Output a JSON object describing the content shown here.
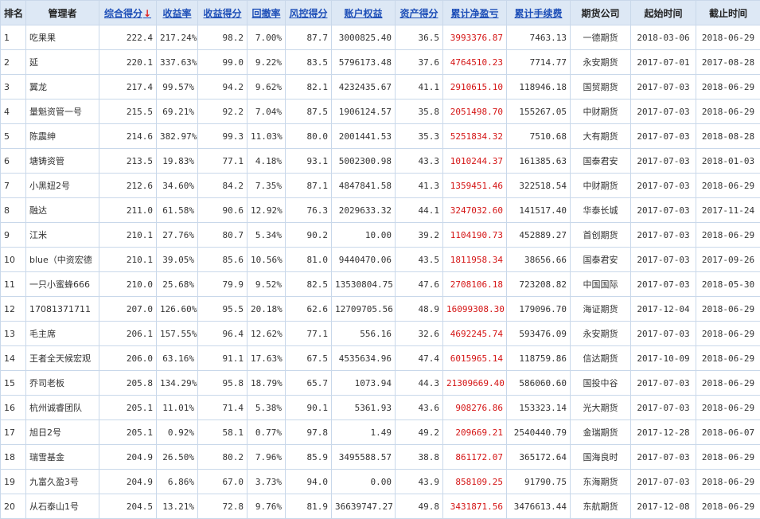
{
  "table": {
    "headers": {
      "rank": "排名",
      "manager": "管理者",
      "composite": "综合得分",
      "return_rate": "收益率",
      "return_score": "收益得分",
      "drawdown": "回撤率",
      "risk_score": "风控得分",
      "equity": "账户权益",
      "asset_score": "资产得分",
      "net_profit": "累计净盈亏",
      "fees": "累计手续费",
      "broker": "期货公司",
      "start": "起始时间",
      "end": "截止时间"
    },
    "sort_icon": "arrow-down-icon",
    "rows": [
      {
        "rank": "1",
        "manager": "吃果果",
        "composite": "222.4",
        "return_rate": "217.24%",
        "return_score": "98.2",
        "drawdown": "7.00%",
        "risk_score": "87.7",
        "equity": "3000825.40",
        "asset_score": "36.5",
        "net_profit": "3993376.87",
        "fees": "7463.13",
        "broker": "一德期货",
        "start": "2018-03-06",
        "end": "2018-06-29"
      },
      {
        "rank": "2",
        "manager": "延",
        "composite": "220.1",
        "return_rate": "337.63%",
        "return_score": "99.0",
        "drawdown": "9.22%",
        "risk_score": "83.5",
        "equity": "5796173.48",
        "asset_score": "37.6",
        "net_profit": "4764510.23",
        "fees": "7714.77",
        "broker": "永安期货",
        "start": "2017-07-01",
        "end": "2017-08-28"
      },
      {
        "rank": "3",
        "manager": "翼龙",
        "composite": "217.4",
        "return_rate": "99.57%",
        "return_score": "94.2",
        "drawdown": "9.62%",
        "risk_score": "82.1",
        "equity": "4232435.67",
        "asset_score": "41.1",
        "net_profit": "2910615.10",
        "fees": "118946.18",
        "broker": "国贸期货",
        "start": "2017-07-03",
        "end": "2018-06-29"
      },
      {
        "rank": "4",
        "manager": "量魁资管一号",
        "composite": "215.5",
        "return_rate": "69.21%",
        "return_score": "92.2",
        "drawdown": "7.04%",
        "risk_score": "87.5",
        "equity": "1906124.57",
        "asset_score": "35.8",
        "net_profit": "2051498.70",
        "fees": "155267.05",
        "broker": "中财期货",
        "start": "2017-07-03",
        "end": "2018-06-29"
      },
      {
        "rank": "5",
        "manager": "陈震绅",
        "composite": "214.6",
        "return_rate": "382.97%",
        "return_score": "99.3",
        "drawdown": "11.03%",
        "risk_score": "80.0",
        "equity": "2001441.53",
        "asset_score": "35.3",
        "net_profit": "5251834.32",
        "fees": "7510.68",
        "broker": "大有期货",
        "start": "2017-07-03",
        "end": "2018-08-28"
      },
      {
        "rank": "6",
        "manager": "塘铸资管",
        "composite": "213.5",
        "return_rate": "19.83%",
        "return_score": "77.1",
        "drawdown": "4.18%",
        "risk_score": "93.1",
        "equity": "5002300.98",
        "asset_score": "43.3",
        "net_profit": "1010244.37",
        "fees": "161385.63",
        "broker": "国泰君安",
        "start": "2017-07-03",
        "end": "2018-01-03"
      },
      {
        "rank": "7",
        "manager": "小黑妞2号",
        "composite": "212.6",
        "return_rate": "34.60%",
        "return_score": "84.2",
        "drawdown": "7.35%",
        "risk_score": "87.1",
        "equity": "4847841.58",
        "asset_score": "41.3",
        "net_profit": "1359451.46",
        "fees": "322518.54",
        "broker": "中财期货",
        "start": "2017-07-03",
        "end": "2018-06-29"
      },
      {
        "rank": "8",
        "manager": "融达",
        "composite": "211.0",
        "return_rate": "61.58%",
        "return_score": "90.6",
        "drawdown": "12.92%",
        "risk_score": "76.3",
        "equity": "2029633.32",
        "asset_score": "44.1",
        "net_profit": "3247032.60",
        "fees": "141517.40",
        "broker": "华泰长城",
        "start": "2017-07-03",
        "end": "2017-11-24"
      },
      {
        "rank": "9",
        "manager": "江米",
        "composite": "210.1",
        "return_rate": "27.76%",
        "return_score": "80.7",
        "drawdown": "5.34%",
        "risk_score": "90.2",
        "equity": "10.00",
        "asset_score": "39.2",
        "net_profit": "1104190.73",
        "fees": "452889.27",
        "broker": "首创期货",
        "start": "2017-07-03",
        "end": "2018-06-29"
      },
      {
        "rank": "10",
        "manager": "blue（中资宏德",
        "composite": "210.1",
        "return_rate": "39.05%",
        "return_score": "85.6",
        "drawdown": "10.56%",
        "risk_score": "81.0",
        "equity": "9440470.06",
        "asset_score": "43.5",
        "net_profit": "1811958.34",
        "fees": "38656.66",
        "broker": "国泰君安",
        "start": "2017-07-03",
        "end": "2017-09-26"
      },
      {
        "rank": "11",
        "manager": "一只小蜜蜂666",
        "composite": "210.0",
        "return_rate": "25.68%",
        "return_score": "79.9",
        "drawdown": "9.52%",
        "risk_score": "82.5",
        "equity": "13530804.75",
        "asset_score": "47.6",
        "net_profit": "2708106.18",
        "fees": "723208.82",
        "broker": "中国国际",
        "start": "2017-07-03",
        "end": "2018-05-30"
      },
      {
        "rank": "12",
        "manager": "17081371711",
        "composite": "207.0",
        "return_rate": "126.60%",
        "return_score": "95.5",
        "drawdown": "20.18%",
        "risk_score": "62.6",
        "equity": "12709705.56",
        "asset_score": "48.9",
        "net_profit": "16099308.30",
        "fees": "179096.70",
        "broker": "海证期货",
        "start": "2017-12-04",
        "end": "2018-06-29"
      },
      {
        "rank": "13",
        "manager": "毛主席",
        "composite": "206.1",
        "return_rate": "157.55%",
        "return_score": "96.4",
        "drawdown": "12.62%",
        "risk_score": "77.1",
        "equity": "556.16",
        "asset_score": "32.6",
        "net_profit": "4692245.74",
        "fees": "593476.09",
        "broker": "永安期货",
        "start": "2017-07-03",
        "end": "2018-06-29"
      },
      {
        "rank": "14",
        "manager": "王者全天候宏观",
        "composite": "206.0",
        "return_rate": "63.16%",
        "return_score": "91.1",
        "drawdown": "17.63%",
        "risk_score": "67.5",
        "equity": "4535634.96",
        "asset_score": "47.4",
        "net_profit": "6015965.14",
        "fees": "118759.86",
        "broker": "信达期货",
        "start": "2017-10-09",
        "end": "2018-06-29"
      },
      {
        "rank": "15",
        "manager": "乔司老板",
        "composite": "205.8",
        "return_rate": "134.29%",
        "return_score": "95.8",
        "drawdown": "18.79%",
        "risk_score": "65.7",
        "equity": "1073.94",
        "asset_score": "44.3",
        "net_profit": "21309669.40",
        "fees": "586060.60",
        "broker": "国投中谷",
        "start": "2017-07-03",
        "end": "2018-06-29"
      },
      {
        "rank": "16",
        "manager": "杭州诚睿团队",
        "composite": "205.1",
        "return_rate": "11.01%",
        "return_score": "71.4",
        "drawdown": "5.38%",
        "risk_score": "90.1",
        "equity": "5361.93",
        "asset_score": "43.6",
        "net_profit": "908276.86",
        "fees": "153323.14",
        "broker": "光大期货",
        "start": "2017-07-03",
        "end": "2018-06-29"
      },
      {
        "rank": "17",
        "manager": "旭日2号",
        "composite": "205.1",
        "return_rate": "0.92%",
        "return_score": "58.1",
        "drawdown": "0.77%",
        "risk_score": "97.8",
        "equity": "1.49",
        "asset_score": "49.2",
        "net_profit": "209669.21",
        "fees": "2540440.79",
        "broker": "金瑞期货",
        "start": "2017-12-28",
        "end": "2018-06-07"
      },
      {
        "rank": "18",
        "manager": "瑞雪基金",
        "composite": "204.9",
        "return_rate": "26.50%",
        "return_score": "80.2",
        "drawdown": "7.96%",
        "risk_score": "85.9",
        "equity": "3495588.57",
        "asset_score": "38.8",
        "net_profit": "861172.07",
        "fees": "365172.64",
        "broker": "国海良时",
        "start": "2017-07-03",
        "end": "2018-06-29"
      },
      {
        "rank": "19",
        "manager": "九富久盈3号",
        "composite": "204.9",
        "return_rate": "6.86%",
        "return_score": "67.0",
        "drawdown": "3.73%",
        "risk_score": "94.0",
        "equity": "0.00",
        "asset_score": "43.9",
        "net_profit": "858109.25",
        "fees": "91790.75",
        "broker": "东海期货",
        "start": "2017-07-03",
        "end": "2018-06-29"
      },
      {
        "rank": "20",
        "manager": "从石泰山1号",
        "composite": "204.5",
        "return_rate": "13.21%",
        "return_score": "72.8",
        "drawdown": "9.76%",
        "risk_score": "81.9",
        "equity": "36639747.27",
        "asset_score": "49.8",
        "net_profit": "3431871.56",
        "fees": "3476613.44",
        "broker": "东航期货",
        "start": "2017-12-08",
        "end": "2018-06-29"
      }
    ]
  }
}
